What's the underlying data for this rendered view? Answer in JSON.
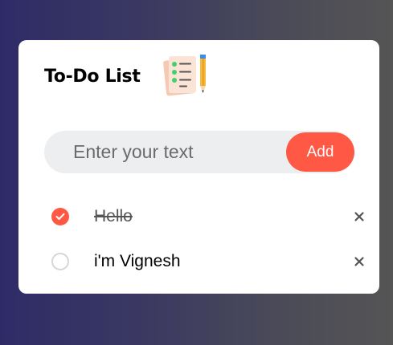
{
  "header": {
    "title": "To-Do List",
    "logo_icon": "checklist-pencil-icon"
  },
  "input": {
    "placeholder": "Enter your text",
    "value": "",
    "add_label": "Add"
  },
  "colors": {
    "accent": "#ff5945",
    "card": "#ffffff",
    "input_bg": "#edeef0",
    "background_start": "#2f2b68",
    "background_end": "#555555"
  },
  "tasks": [
    {
      "text": "Hello",
      "checked": true
    },
    {
      "text": "i'm Vignesh",
      "checked": false
    }
  ]
}
